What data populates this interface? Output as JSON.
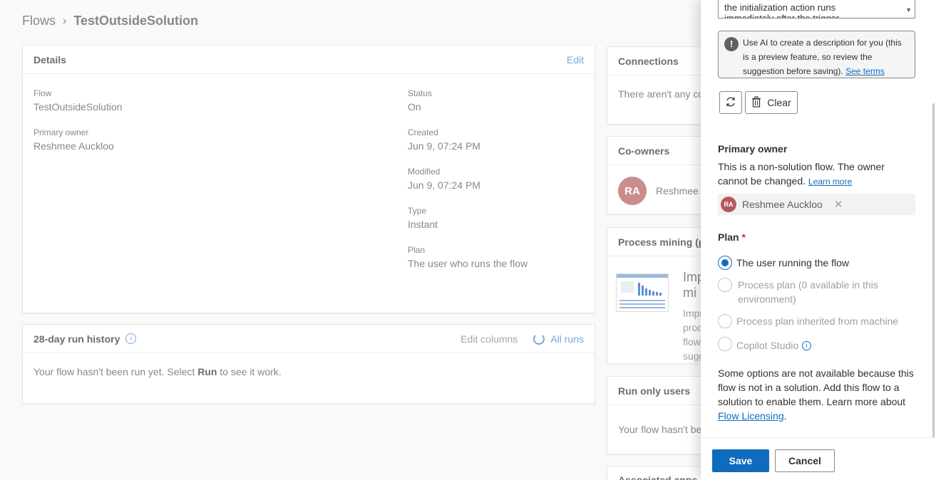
{
  "breadcrumb": {
    "root": "Flows",
    "current": "TestOutsideSolution"
  },
  "details": {
    "title": "Details",
    "edit": "Edit",
    "flow_label": "Flow",
    "flow_value": "TestOutsideSolution",
    "owner_label": "Primary owner",
    "owner_value": "Reshmee Auckloo",
    "status_label": "Status",
    "status_value": "On",
    "created_label": "Created",
    "created_value": "Jun 9, 07:24 PM",
    "modified_label": "Modified",
    "modified_value": "Jun 9, 07:24 PM",
    "type_label": "Type",
    "type_value": "Instant",
    "plan_label": "Plan",
    "plan_value": "The user who runs the flow"
  },
  "run_history": {
    "title": "28-day run history",
    "edit_columns": "Edit columns",
    "all_runs": "All runs",
    "message_pre": "Your flow hasn't been run yet. Select ",
    "message_bold": "Run",
    "message_post": " to see it work."
  },
  "connections": {
    "title": "Connections",
    "text": "There aren't any co"
  },
  "coowners": {
    "title": "Co-owners",
    "initials": "RA",
    "name": "Reshmee A"
  },
  "process_mining": {
    "title": "Process mining (p",
    "heading1": "Imp",
    "heading2": "mi",
    "lines": [
      "Impr",
      "proc",
      "flow",
      "sugg"
    ]
  },
  "run_only": {
    "title": "Run only users",
    "text": "Your flow hasn't be"
  },
  "associated": {
    "title": "Associated apps"
  },
  "panel": {
    "description_line1": "the initialization action runs",
    "description_line2": "immediately after the trigger",
    "ai_notice": "Use AI to create a description for you (this is a preview feature, so review the suggestion before saving).",
    "see_terms": "See terms",
    "clear": "Clear",
    "primary_owner_title": "Primary owner",
    "owner_note": "This is a non-solution flow. The owner cannot be changed.",
    "learn_more": "Learn more",
    "owner_initials": "RA",
    "owner_name": "Reshmee Auckloo",
    "plan_title": "Plan",
    "required_mark": "*",
    "options": [
      "The user running the flow",
      "Process plan (0 available in this environment)",
      "Process plan inherited from machine",
      "Copilot Studio"
    ],
    "note": "Some options are not available because this flow is not in a solution. Add this flow to a solution to enable them. Learn more about",
    "licensing_link": "Flow Licensing",
    "save": "Save",
    "cancel": "Cancel"
  },
  "colors": {
    "primary": "#0f6cbd",
    "avatar": "#c17a7a",
    "required": "#c4314b"
  }
}
